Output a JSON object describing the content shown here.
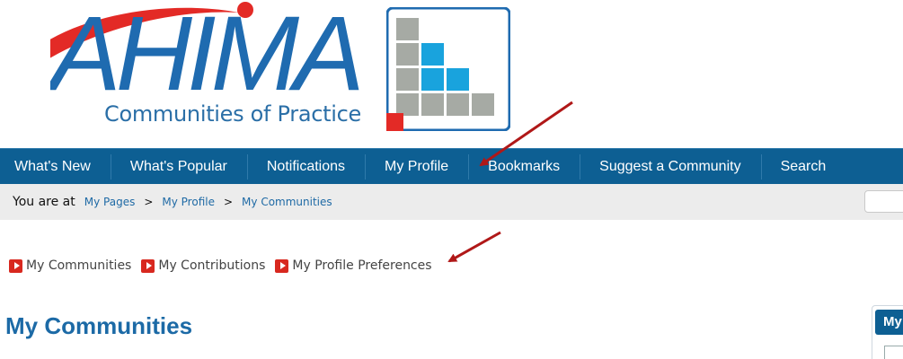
{
  "logo": {
    "wordmark": "AHIMA",
    "subtitle": "Communities of Practice",
    "colors": {
      "blue": "#1f6bb0",
      "red": "#e32a26",
      "gray": "#a6aaa4",
      "cyan": "#19a3dd"
    }
  },
  "nav": {
    "items": [
      {
        "label": "What's New"
      },
      {
        "label": "What's Popular"
      },
      {
        "label": "Notifications"
      },
      {
        "label": "My Profile"
      },
      {
        "label": "Bookmarks"
      },
      {
        "label": "Suggest a Community"
      },
      {
        "label": "Search"
      }
    ],
    "background": "#0d5f93"
  },
  "breadcrumb": {
    "prefix": "You are at",
    "items": [
      {
        "label": "My Pages"
      },
      {
        "label": "My Profile"
      },
      {
        "label": "My Communities"
      }
    ],
    "separator": ">"
  },
  "sublinks": [
    {
      "label": "My Communities",
      "icon": "play-icon"
    },
    {
      "label": "My Contributions",
      "icon": "play-icon"
    },
    {
      "label": "My Profile Preferences",
      "icon": "play-icon"
    }
  ],
  "page": {
    "title": "My Communities"
  },
  "side_panel": {
    "header": "My"
  }
}
